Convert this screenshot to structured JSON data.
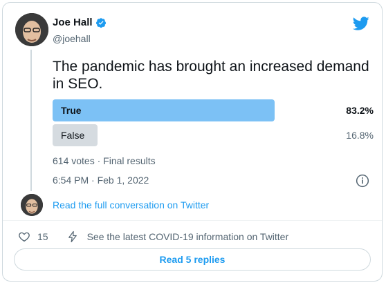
{
  "author": {
    "name": "Joe Hall",
    "handle": "@joehall",
    "verified_icon": "verified-badge-icon"
  },
  "tweet": {
    "text": "The pandemic has brought an increased demand in SEO.",
    "timestamp": "6:54 PM · Feb 1, 2022"
  },
  "poll": {
    "options": [
      {
        "label": "True",
        "percent": "83.2%",
        "value": 0.832,
        "winner": true
      },
      {
        "label": "False",
        "percent": "16.8%",
        "value": 0.168,
        "winner": false
      }
    ],
    "votes_summary": "614 votes · Final results"
  },
  "links": {
    "read_full": "Read the full conversation on Twitter",
    "covid_info": "See the latest COVID-19 information on Twitter",
    "read_replies": "Read 5 replies"
  },
  "engagement": {
    "likes": "15"
  },
  "colors": {
    "accent": "#1d9bf0",
    "winner_bar": "#7cc1f5",
    "loser_bar": "#d5dbe0"
  }
}
